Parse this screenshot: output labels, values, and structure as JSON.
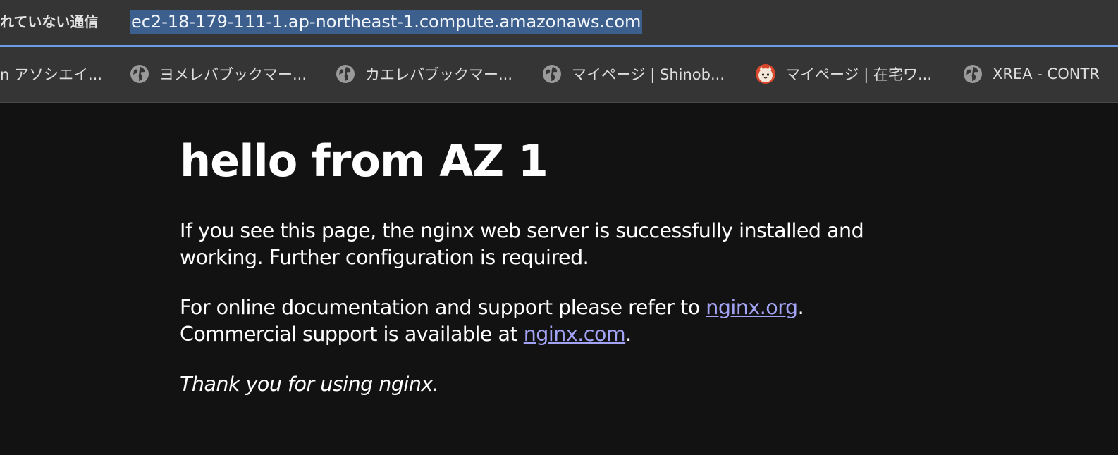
{
  "browser": {
    "security_label": "れていない通信",
    "url": "ec2-18-179-111-1.ap-northeast-1.compute.amazonaws.com",
    "accent_color": "#6d9ce6"
  },
  "bookmarks": [
    {
      "label": "n アソシエイ...",
      "icon": "none"
    },
    {
      "label": "ヨメレバブックマー...",
      "icon": "globe-icon"
    },
    {
      "label": "カエレバブックマー...",
      "icon": "globe-icon"
    },
    {
      "label": "マイページ | Shinob...",
      "icon": "globe-icon"
    },
    {
      "label": "マイページ | 在宅ワ...",
      "icon": "cat-favicon"
    },
    {
      "label": "XREA - CONTR",
      "icon": "globe-icon"
    }
  ],
  "page": {
    "heading": "hello from AZ 1",
    "p1": "If you see this page, the nginx web server is successfully installed and working. Further configuration is required.",
    "p2_prefix": "For online documentation and support please refer to ",
    "link_org": "nginx.org",
    "p2_mid": ".",
    "p2_line2_prefix": "Commercial support is available at ",
    "link_com": "nginx.com",
    "p2_end": ".",
    "thanks": "Thank you for using nginx.",
    "link_color": "#a3a3f5"
  }
}
